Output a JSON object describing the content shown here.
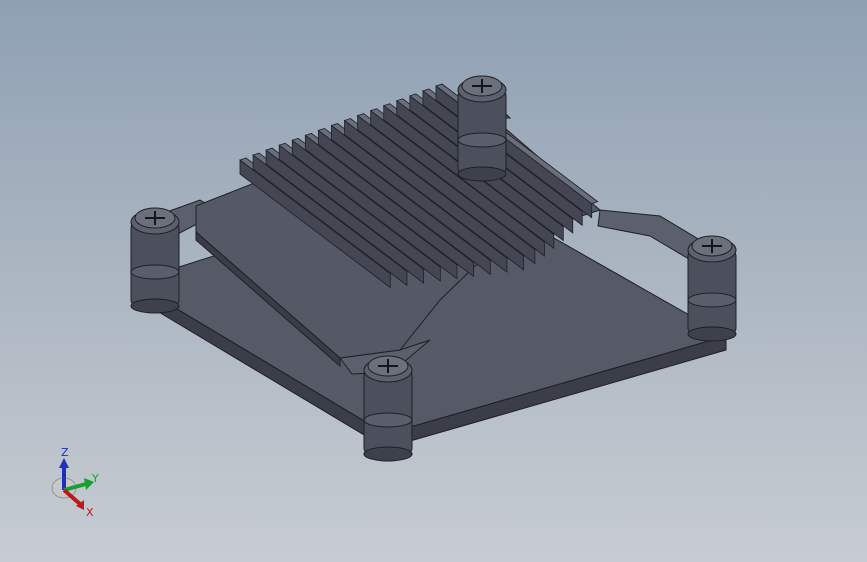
{
  "model_view": {
    "background_top": "#8fa0b4",
    "background_bottom": "#c7ccd2",
    "part_color": "#4e5260",
    "edge_color": "#1d1f26",
    "fin_count": 16,
    "standoff_count": 4
  },
  "triad": {
    "z_label": "Z",
    "y_label": "Y",
    "x_label": "X",
    "z_color": "#1f2fb8",
    "y_color": "#18a030",
    "x_color": "#c01818"
  }
}
